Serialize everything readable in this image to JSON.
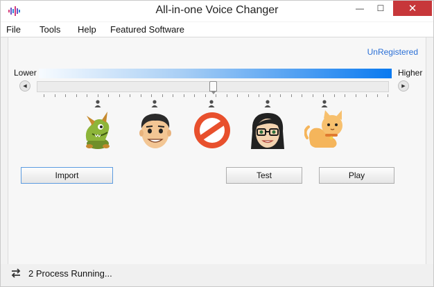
{
  "window": {
    "title": "All-in-one Voice Changer",
    "minimize_glyph": "—",
    "maximize_glyph": "☐",
    "close_glyph": "✕"
  },
  "menu": {
    "items": [
      "File",
      "Tools",
      "Help",
      "Featured Software"
    ]
  },
  "registration": {
    "label": "UnRegistered"
  },
  "pitch": {
    "lower_label": "Lower",
    "higher_label": "Higher",
    "slider_value_fraction": 0.5,
    "left_arrow_glyph": "◀",
    "right_arrow_glyph": "▶"
  },
  "voices": [
    {
      "name": "dragon",
      "icon": "dragon-icon"
    },
    {
      "name": "man",
      "icon": "man-face-icon"
    },
    {
      "name": "none",
      "icon": "no-effect-icon"
    },
    {
      "name": "woman",
      "icon": "woman-face-icon"
    },
    {
      "name": "cat",
      "icon": "cat-icon"
    }
  ],
  "buttons": {
    "import_label": "Import",
    "test_label": "Test",
    "play_label": "Play"
  },
  "status": {
    "text": "2 Process Running..."
  },
  "colors": {
    "accent": "#0a7af0",
    "close_button": "#c7373a",
    "link": "#2a6fd6"
  }
}
